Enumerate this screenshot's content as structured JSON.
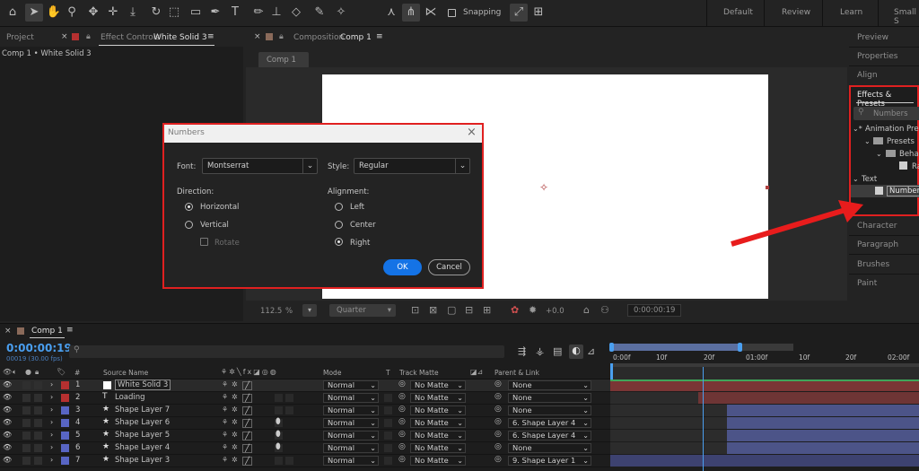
{
  "toolbar": {
    "snapping_label": "Snapping",
    "workspaces": [
      "Default",
      "Review",
      "Learn",
      "Small S"
    ]
  },
  "left_panel": {
    "tab_project": "Project",
    "tab_effect_controls": "Effect Controls",
    "tab_effect_target": "White Solid 3",
    "subtitle": "Comp 1 • White Solid 3"
  },
  "composition": {
    "tab_prefix": "Composition",
    "tab_name": "Comp 1",
    "comp_chip": "Comp 1",
    "zoom": "112.5",
    "zoom_unit": "%",
    "resolution": "Quarter",
    "exposure": "+0.0",
    "timecode": "0:00:00:19"
  },
  "right_panel": {
    "items_top": [
      "Preview",
      "Properties",
      "Align"
    ],
    "effects_title": "Effects & Presets",
    "search_value": "Numbers",
    "tree": [
      "Animation Pres",
      "Presets",
      "Beha",
      "Ra",
      "Text",
      "Numbers"
    ],
    "items_bottom": [
      "Character",
      "Paragraph",
      "Brushes",
      "Paint"
    ]
  },
  "dialog": {
    "title": "Numbers",
    "font_label": "Font:",
    "font_value": "Montserrat",
    "style_label": "Style:",
    "style_value": "Regular",
    "direction_label": "Direction:",
    "direction_options": [
      "Horizontal",
      "Vertical"
    ],
    "rotate_label": "Rotate",
    "alignment_label": "Alignment:",
    "alignment_options": [
      "Left",
      "Center",
      "Right"
    ],
    "ok_label": "OK",
    "cancel_label": "Cancel"
  },
  "timeline": {
    "tab_name": "Comp 1",
    "timecode": "0:00:00:19",
    "fps_info": "00019 (30.00 fps)",
    "col_hash": "#",
    "col_source": "Source Name",
    "col_mode": "Mode",
    "col_t": "T",
    "col_track_matte": "Track Matte",
    "col_parent": "Parent & Link",
    "ruler": [
      "0:00f",
      "10f",
      "20f",
      "01:00f",
      "10f",
      "20f",
      "02:00f"
    ],
    "layers": [
      {
        "num": "1",
        "name": "White Solid 3",
        "mode": "Normal",
        "matte": "No Matte",
        "parent": "None"
      },
      {
        "num": "2",
        "name": "Loading",
        "mode": "Normal",
        "matte": "No Matte",
        "parent": "None"
      },
      {
        "num": "3",
        "name": "Shape Layer 7",
        "mode": "Normal",
        "matte": "No Matte",
        "parent": "None"
      },
      {
        "num": "4",
        "name": "Shape Layer 6",
        "mode": "Normal",
        "matte": "No Matte",
        "parent": "6. Shape Layer 4"
      },
      {
        "num": "5",
        "name": "Shape Layer 5",
        "mode": "Normal",
        "matte": "No Matte",
        "parent": "6. Shape Layer 4"
      },
      {
        "num": "6",
        "name": "Shape Layer 4",
        "mode": "Normal",
        "matte": "No Matte",
        "parent": "None"
      },
      {
        "num": "7",
        "name": "Shape Layer 3",
        "mode": "Normal",
        "matte": "No Matte",
        "parent": "9. Shape Layer 1"
      }
    ]
  },
  "colors": {
    "accent_blue": "#1473e6",
    "highlight_red": "#e02020",
    "label_red": "#b53030",
    "label_blue": "#5865c4"
  }
}
